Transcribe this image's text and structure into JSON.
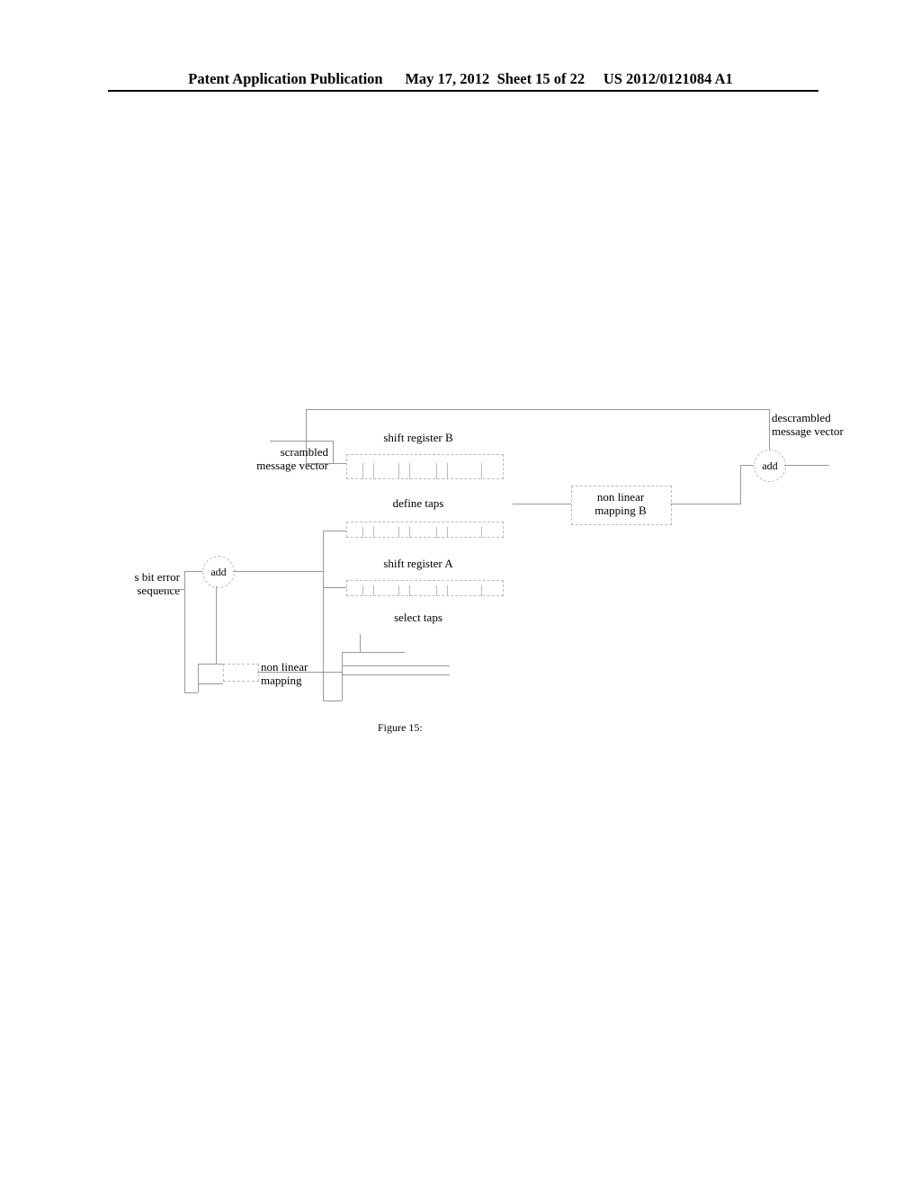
{
  "header": {
    "pub_type": "Patent Application Publication",
    "date": "May 17, 2012",
    "sheet": "Sheet 15 of 22",
    "pubnum": "US 2012/0121084 A1"
  },
  "labels": {
    "s_bit_error": "s bit error sequence",
    "scrambled_msg": "scrambled message vector",
    "descrambled_msg": "descrambled message vector",
    "shift_reg_a": "shift register A",
    "shift_reg_b": "shift register B",
    "define_taps": "define taps",
    "select_taps": "select taps",
    "nonlin_map": "non linear mapping",
    "nonlin_map_b": "non linear mapping B",
    "add": "add",
    "figure": "Figure 15:"
  }
}
